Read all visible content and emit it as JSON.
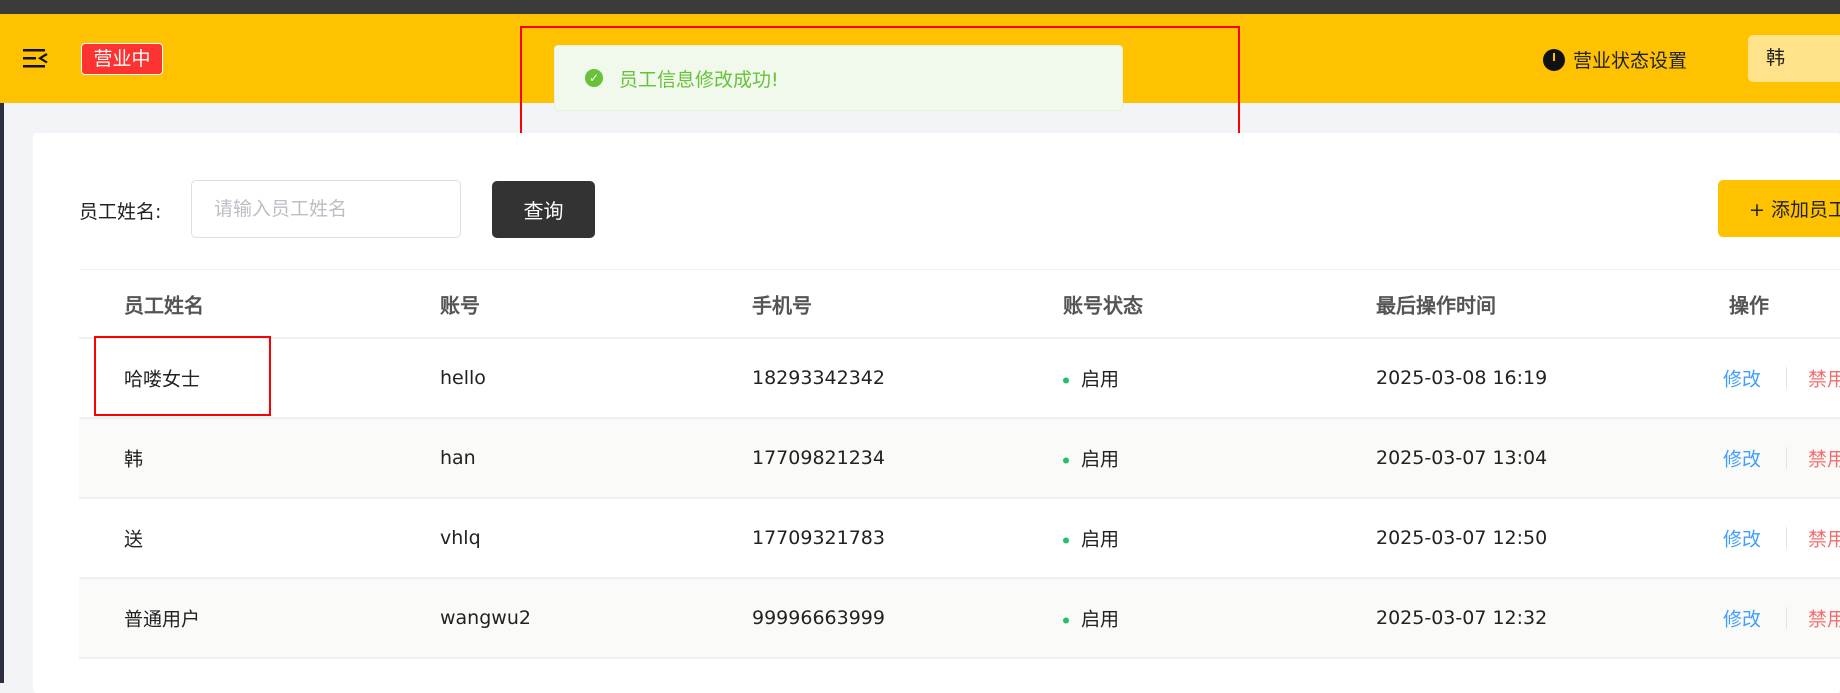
{
  "header": {
    "shop_status_badge": "营业中",
    "status_settings_label": "营业状态设置",
    "user_name": "韩"
  },
  "toast": {
    "message": "员工信息修改成功!",
    "color": "#67c23a"
  },
  "search": {
    "label": "员工姓名:",
    "placeholder": "请输入员工姓名",
    "value": "",
    "query_button": "查询",
    "add_button": "+ 添加员工"
  },
  "table": {
    "columns": [
      "员工姓名",
      "账号",
      "手机号",
      "账号状态",
      "最后操作时间",
      "操作"
    ],
    "rows": [
      {
        "name": "哈喽女士",
        "account": "hello",
        "phone": "18293342342",
        "status": "启用",
        "time": "2025-03-08 16:19",
        "edit": "修改",
        "disable": "禁用"
      },
      {
        "name": "韩",
        "account": "han",
        "phone": "17709821234",
        "status": "启用",
        "time": "2025-03-07 13:04",
        "edit": "修改",
        "disable": "禁用"
      },
      {
        "name": "送",
        "account": "vhlq",
        "phone": "17709321783",
        "status": "启用",
        "time": "2025-03-07 12:50",
        "edit": "修改",
        "disable": "禁用"
      },
      {
        "name": "普通用户",
        "account": "wangwu2",
        "phone": "99996663999",
        "status": "启用",
        "time": "2025-03-07 12:32",
        "edit": "修改",
        "disable": "禁用"
      }
    ]
  },
  "colors": {
    "brand": "#ffc200",
    "link": "#409eff",
    "danger": "#f56c6c",
    "status_on": "#20c06c"
  }
}
